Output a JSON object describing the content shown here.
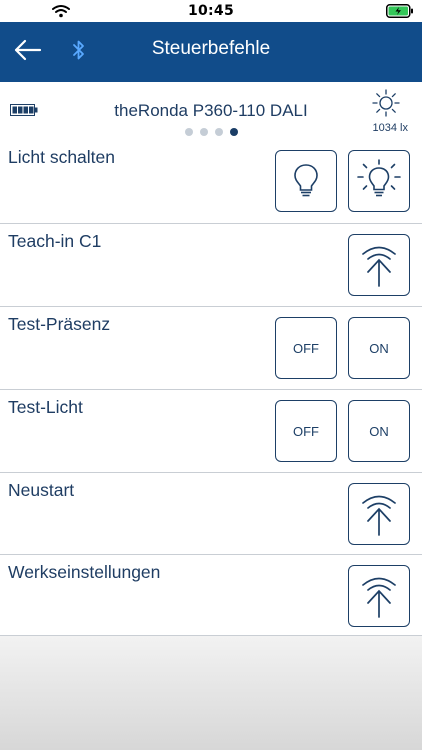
{
  "status_bar": {
    "time": "10:45"
  },
  "nav": {
    "title": "Steuerbefehle",
    "back_icon": "arrow-left-icon",
    "bluetooth_icon": "bluetooth-icon"
  },
  "device": {
    "name": "theRonda P360-110 DALI",
    "lux": "1034 lx",
    "page_count": 4,
    "active_page": 4
  },
  "commands": [
    {
      "label": "Licht schalten",
      "buttons": [
        {
          "icon": "bulb-off-icon"
        },
        {
          "icon": "bulb-on-icon"
        }
      ]
    },
    {
      "label": "Teach-in C1",
      "buttons": [
        {
          "icon": "signal-send-icon"
        }
      ]
    },
    {
      "label": "Test-Präsenz",
      "buttons": [
        {
          "text": "OFF"
        },
        {
          "text": "ON"
        }
      ]
    },
    {
      "label": "Test-Licht",
      "buttons": [
        {
          "text": "OFF"
        },
        {
          "text": "ON"
        }
      ]
    },
    {
      "label": "Neustart",
      "buttons": [
        {
          "icon": "signal-send-icon"
        }
      ]
    },
    {
      "label": "Werkseinstellungen",
      "buttons": [
        {
          "icon": "signal-send-icon"
        }
      ]
    }
  ],
  "colors": {
    "brand": "#114c8a",
    "text": "#1f3d63",
    "battery_ios": "#34c759"
  }
}
